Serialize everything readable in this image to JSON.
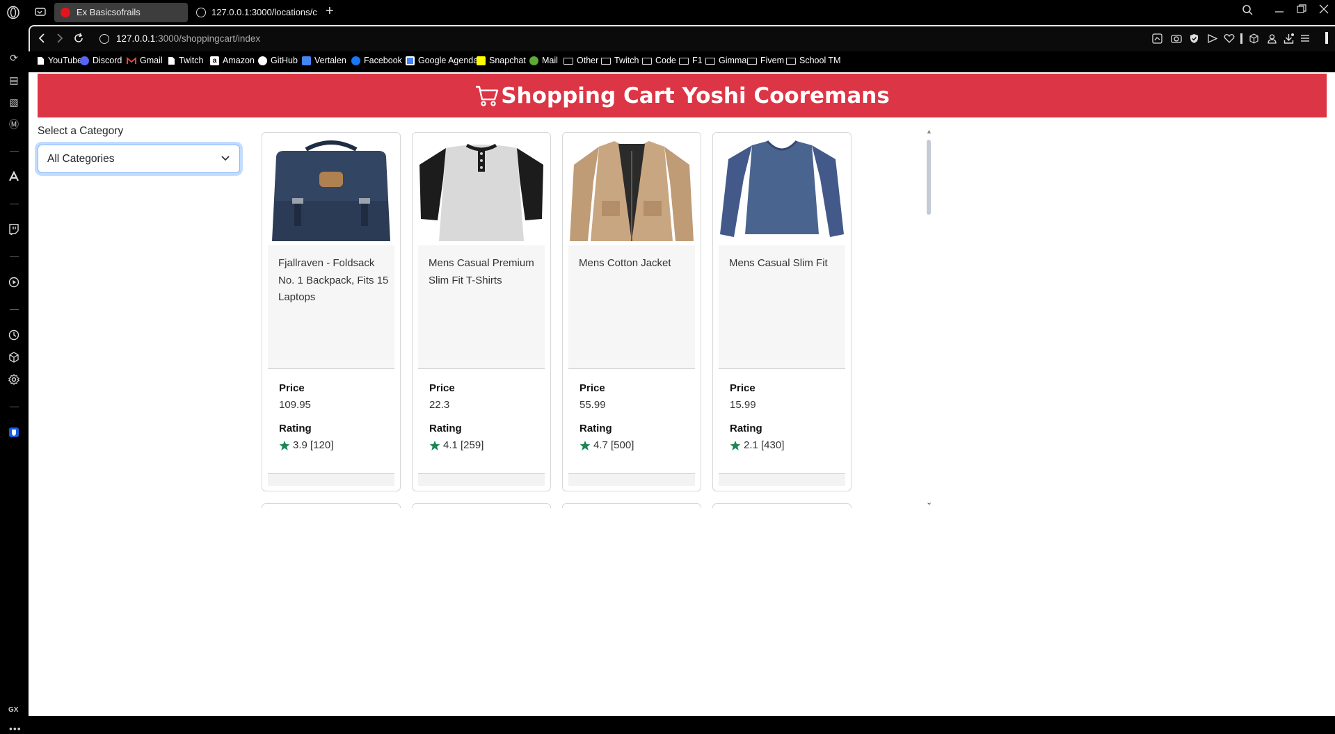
{
  "browser": {
    "tabs": [
      {
        "title": "Ex Basicsofrails"
      },
      {
        "title": "127.0.0.1:3000/locations/c"
      }
    ],
    "address": {
      "host": "127.0.0.1",
      "path": ":3000/shoppingcart/index"
    },
    "bookmarks": [
      {
        "label": "YouTube",
        "icon": "page-icon"
      },
      {
        "label": "Discord",
        "icon": "discord-icon"
      },
      {
        "label": "Gmail",
        "icon": "gmail-icon"
      },
      {
        "label": "Twitch",
        "icon": "page-icon"
      },
      {
        "label": "Amazon",
        "icon": "amazon-icon"
      },
      {
        "label": "GitHub",
        "icon": "github-icon"
      },
      {
        "label": "Vertalen",
        "icon": "translate-icon"
      },
      {
        "label": "Facebook",
        "icon": "facebook-icon"
      },
      {
        "label": "Google Agenda",
        "icon": "calendar-icon"
      },
      {
        "label": "Snapchat",
        "icon": "snapchat-icon"
      },
      {
        "label": "Mail",
        "icon": "mail-icon"
      },
      {
        "label": "Other",
        "icon": "folder-icon"
      },
      {
        "label": "Twitch",
        "icon": "folder-icon"
      },
      {
        "label": "Code",
        "icon": "folder-icon"
      },
      {
        "label": "F1",
        "icon": "folder-icon"
      },
      {
        "label": "Gimma",
        "icon": "folder-icon"
      },
      {
        "label": "Fivem",
        "icon": "folder-icon"
      },
      {
        "label": "School TM",
        "icon": "folder-icon"
      }
    ],
    "sidebar_label": "GX"
  },
  "page": {
    "header_title": "Shopping Cart Yoshi Cooremans",
    "header_color": "#dc3545",
    "category": {
      "label": "Select a Category",
      "selected": "All Categories"
    },
    "price_label": "Price",
    "rating_label": "Rating",
    "star_color": "#198754",
    "products": [
      {
        "title": "Fjallraven - Foldsack No. 1 Backpack, Fits 15 Laptops",
        "price": "109.95",
        "rating": "3.9 [120]",
        "image": "backpack"
      },
      {
        "title": "Mens Casual Premium Slim Fit T-Shirts",
        "price": "22.3",
        "rating": "4.1 [259]",
        "image": "raglan-shirt"
      },
      {
        "title": "Mens Cotton Jacket",
        "price": "55.99",
        "rating": "4.7 [500]",
        "image": "jacket"
      },
      {
        "title": "Mens Casual Slim Fit",
        "price": "15.99",
        "rating": "2.1 [430]",
        "image": "longsleeve"
      }
    ]
  }
}
